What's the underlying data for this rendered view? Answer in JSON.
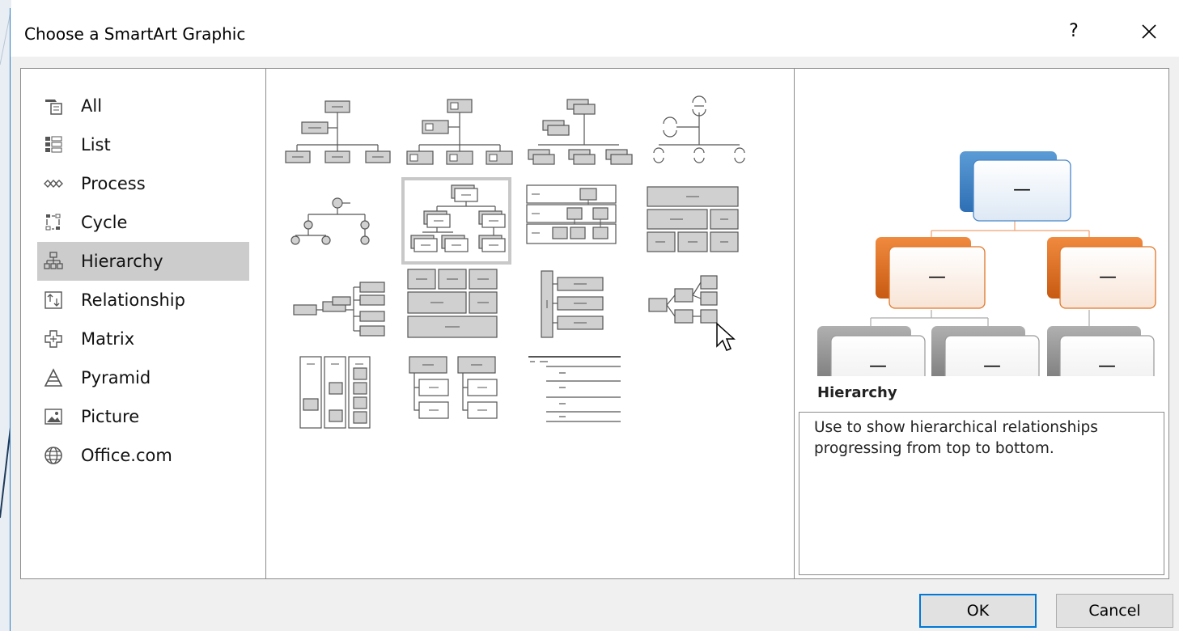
{
  "dialog": {
    "title": "Choose a SmartArt Graphic",
    "help_glyph": "?",
    "close_icon": "close-icon"
  },
  "categories": [
    {
      "label": "All",
      "icon": "all-icon"
    },
    {
      "label": "List",
      "icon": "list-icon"
    },
    {
      "label": "Process",
      "icon": "process-icon"
    },
    {
      "label": "Cycle",
      "icon": "cycle-icon"
    },
    {
      "label": "Hierarchy",
      "icon": "hierarchy-icon",
      "selected": true
    },
    {
      "label": "Relationship",
      "icon": "relationship-icon"
    },
    {
      "label": "Matrix",
      "icon": "matrix-icon"
    },
    {
      "label": "Pyramid",
      "icon": "pyramid-icon"
    },
    {
      "label": "Picture",
      "icon": "picture-icon"
    },
    {
      "label": "Office.com",
      "icon": "globe-icon"
    }
  ],
  "preview": {
    "name": "Hierarchy",
    "description": "Use to show hierarchical relationships progressing from top to bottom.",
    "node_glyph": "—",
    "colors": {
      "top": "#4a86c8",
      "middle": "#e07628",
      "bottom": "#8c8c8c"
    }
  },
  "buttons": {
    "ok": "OK",
    "cancel": "Cancel"
  }
}
